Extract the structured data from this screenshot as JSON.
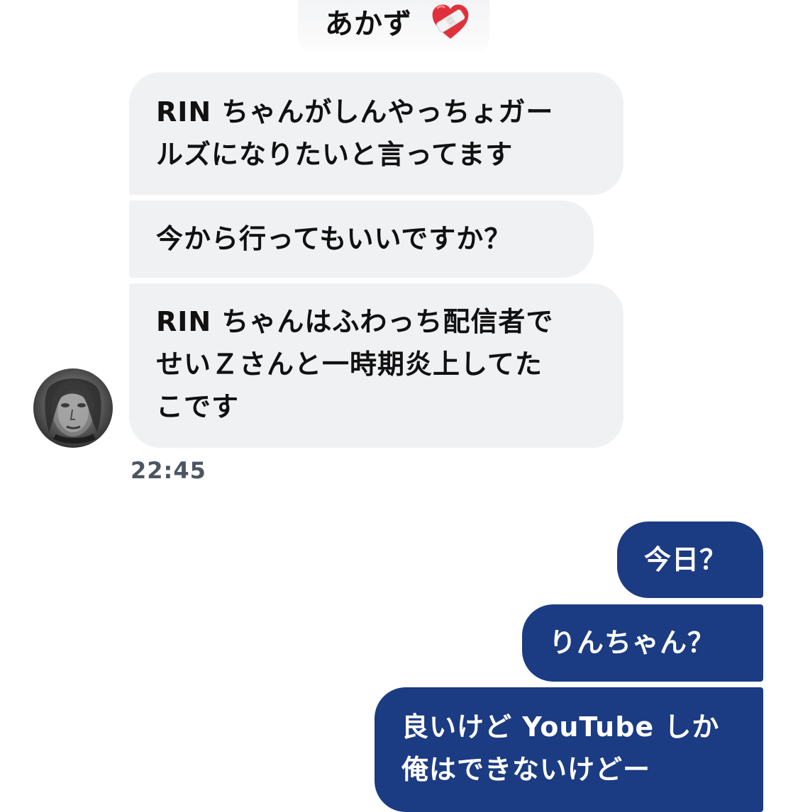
{
  "header": {
    "contact_name": "あかず",
    "contact_emoji": "mending-heart-icon"
  },
  "conversation": {
    "incoming": [
      {
        "text": "RIN ちゃんがしんやっちょガー\nルズになりたいと言ってます"
      },
      {
        "text": "今から行ってもいいですか？"
      },
      {
        "text": "RIN ちゃんはふわっち配信者で\nせいＺさんと一時期炎上してた\nこです"
      }
    ],
    "incoming_timestamp": "22:45",
    "outgoing": [
      {
        "text": "今日？"
      },
      {
        "text": "りんちゃん？"
      },
      {
        "text": "良いけど YouTube しか\n俺はできないけどー"
      }
    ]
  },
  "colors": {
    "incoming_bubble": "#eff1f3",
    "outgoing_bubble": "#1b3b82",
    "timestamp": "#4b5563"
  }
}
